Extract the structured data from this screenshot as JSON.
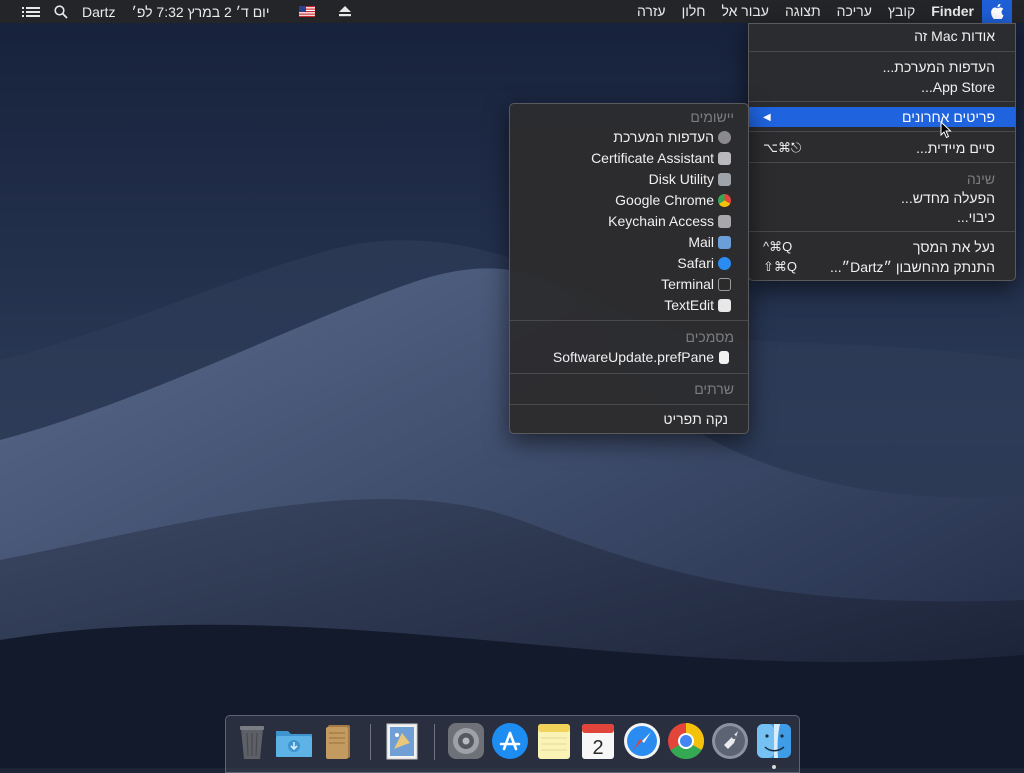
{
  "menubar": {
    "apple_icon": "apple-icon",
    "items": [
      "Finder",
      "קובץ",
      "עריכה",
      "תצוגה",
      "עבור אל",
      "חלון",
      "עזרה"
    ],
    "status": {
      "list_icon": "menu-list-icon",
      "search_icon": "spotlight-search-icon",
      "user": "Dartz",
      "clock": "יום ד׳ 2 במרץ  7:32 לפ׳",
      "input_flag": "us-flag-icon",
      "eject_icon": "eject-icon"
    }
  },
  "apple_menu": {
    "about": "אודות Mac זה",
    "system_prefs": "העדפות המערכת...",
    "app_store": "App Store...",
    "recent_items": "פריטים אחרונים",
    "force_quit": "סיים מיידית...",
    "force_quit_shortcut": "⌥⌘⎋",
    "sleep": "שינה",
    "restart": "הפעלה מחדש...",
    "shutdown": "כיבוי...",
    "lock_screen": "נעל את המסך",
    "lock_screen_shortcut": "^⌘Q",
    "logout": "התנתק מהחשבון ״Dartz״...",
    "logout_shortcut": "⇧⌘Q"
  },
  "recent_menu": {
    "apps_header": "יישומים",
    "apps": [
      {
        "label": "העדפות המערכת",
        "icon": "system-preferences-icon",
        "color": "#8a8a8e"
      },
      {
        "label": "Certificate Assistant",
        "icon": "certificate-assistant-icon",
        "color": "#b9b9bd"
      },
      {
        "label": "Disk Utility",
        "icon": "disk-utility-icon",
        "color": "#9fa3aa"
      },
      {
        "label": "Google Chrome",
        "icon": "chrome-icon",
        "color": "#e4453a"
      },
      {
        "label": "Keychain Access",
        "icon": "keychain-access-icon",
        "color": "#a8a8ac"
      },
      {
        "label": "Mail",
        "icon": "mail-icon",
        "color": "#6a9fd8"
      },
      {
        "label": "Safari",
        "icon": "safari-icon",
        "color": "#2a8cf0"
      },
      {
        "label": "Terminal",
        "icon": "terminal-icon",
        "color": "#2b2b2b"
      },
      {
        "label": "TextEdit",
        "icon": "textedit-icon",
        "color": "#e8e8e8"
      }
    ],
    "docs_header": "מסמכים",
    "docs": [
      {
        "label": "SoftwareUpdate.prefPane",
        "icon": "document-icon",
        "color": "#f2f2f2"
      }
    ],
    "servers_header": "שרתים",
    "clear": "נקה תפריט"
  },
  "dock": {
    "items": [
      {
        "name": "trash-icon",
        "color": "#5d6066"
      },
      {
        "name": "downloads-folder-icon",
        "color": "#4ea5dc"
      },
      {
        "name": "documents-stack-icon",
        "color": "#b58a52"
      },
      {
        "name": "mail-stamp-icon",
        "color": "#4a78b8"
      },
      {
        "name": "system-preferences-icon",
        "color": "#7c7f86"
      },
      {
        "name": "app-store-icon",
        "color": "#1e8df2"
      },
      {
        "name": "notes-icon",
        "color": "#f3e27a"
      },
      {
        "name": "calendar-icon",
        "color": "#f5f5f5"
      },
      {
        "name": "safari-icon",
        "color": "#2a8cf0"
      },
      {
        "name": "chrome-icon",
        "color": "#e4453a"
      },
      {
        "name": "launchpad-icon",
        "color": "#8b93a3"
      },
      {
        "name": "finder-icon",
        "color": "#3f9de7"
      }
    ],
    "calendar_day": "2"
  }
}
